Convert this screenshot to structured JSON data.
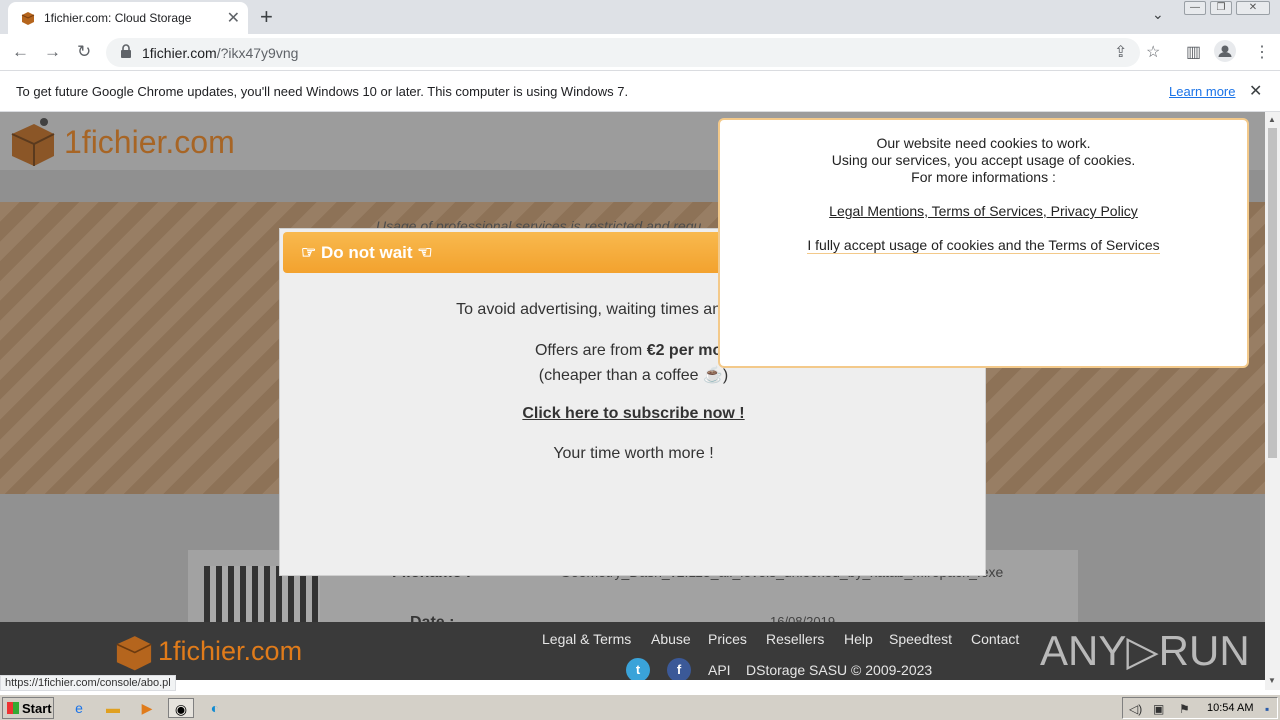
{
  "browser": {
    "tab_title": "1fichier.com: Cloud Storage",
    "new_tab": "+",
    "url_host": "1fichier.com",
    "url_path": "/?ikx47y9vng",
    "icons": [
      "back-arrow-icon",
      "forward-arrow-icon",
      "reload-icon",
      "lock-icon",
      "share-icon",
      "star-icon",
      "sidepanel-icon",
      "profile-icon",
      "menu-icon"
    ]
  },
  "infobar": {
    "message": "To get future Google Chrome updates, you'll need Windows 10 or later. This computer is using Windows 7.",
    "learn_more": "Learn more",
    "close": "✕"
  },
  "site": {
    "logo_text": "1fichier.com",
    "notice": "Usage of professional services is restricted and requ",
    "file": {
      "name_label": "Filename :",
      "name_value": "Geometry_Dash_v2.113_all_levels_unlocked_by_xatab_Mirepack_.exe",
      "date_label": "Date :",
      "date_value": "16/08/2019"
    }
  },
  "modal": {
    "title": "☞ Do not wait ☜",
    "line1": "To avoid advertising, waiting times and speed limit",
    "offers_prefix": "Offers are from ",
    "offers_bold": "€2 per mon",
    "cheaper": "(cheaper than a coffee ☕)",
    "subscribe": "Click here to subscribe now !",
    "time": "Your time worth more !"
  },
  "cookie": {
    "line1": "Our website need cookies to work.",
    "line2": "Using our services, you accept usage of cookies.",
    "line3": "For more informations :",
    "links": "Legal Mentions, Terms of Services, Privacy Policy",
    "accept": "I fully accept usage of cookies and the Terms of Services"
  },
  "footer": {
    "logo_text": "1fichier.com",
    "links": [
      "Legal & Terms",
      "Abuse",
      "Prices",
      "Resellers",
      "Help",
      "Speedtest",
      "Contact"
    ],
    "api": "API",
    "copyright": "DStorage SASU © 2009-2023",
    "twitter": "t",
    "facebook": "f"
  },
  "watermark": "ANY▷RUN",
  "status_url": "https://1fichier.com/console/abo.pl",
  "taskbar": {
    "start": "Start",
    "time": "10:54 AM"
  }
}
